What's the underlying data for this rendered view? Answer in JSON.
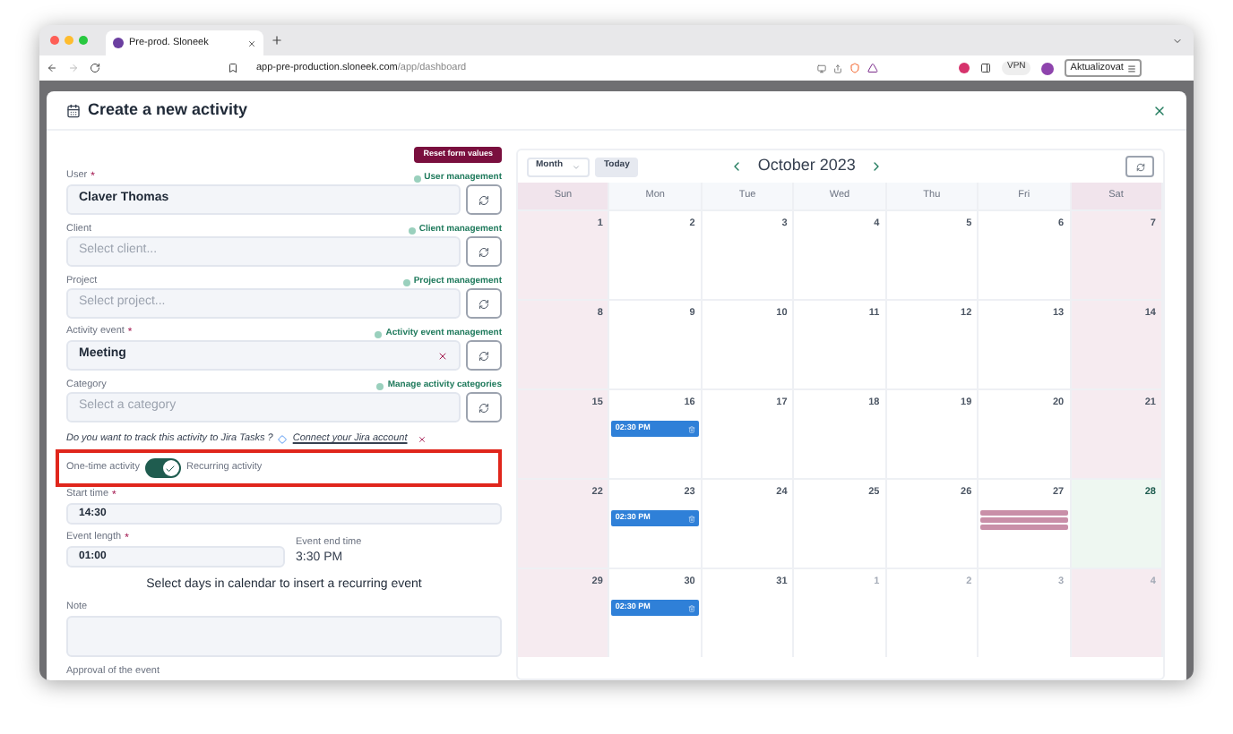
{
  "browser": {
    "tab_title": "Pre-prod. Sloneek",
    "url_host": "app-pre-production.sloneek.com",
    "url_path": "/app/dashboard",
    "vpn": "VPN",
    "update_button": "Aktualizovat"
  },
  "modal": {
    "title": "Create a new activity",
    "reset_button": "Reset form values"
  },
  "fields": [
    {
      "label": "User",
      "required_mark": "*",
      "link": "User management",
      "value": "Claver Thomas",
      "clearable": false
    },
    {
      "label": "Client",
      "link": "Client management",
      "placeholder": "Select client...",
      "clearable": false
    },
    {
      "label": "Project",
      "link": "Project management",
      "placeholder": "Select project...",
      "clearable": false
    },
    {
      "label": "Activity event",
      "required_mark": "*",
      "link": "Activity event management",
      "value": "Meeting",
      "clearable": true
    },
    {
      "label": "Category",
      "link": "Manage activity categories",
      "placeholder": "Select a category",
      "clearable": false
    }
  ],
  "jira": {
    "question": "Do you want to track this activity to Jira Tasks ?",
    "link": "Connect your Jira account"
  },
  "toggle": {
    "left_label": "One-time activity",
    "right_label": "Recurring activity",
    "on": true,
    "highlighted": true
  },
  "start_time": {
    "label": "Start time",
    "required_mark": "*",
    "value": "14:30"
  },
  "event_length": {
    "label": "Event length",
    "required_mark": "*",
    "value": "01:00"
  },
  "end_time": {
    "label": "Event end time",
    "value": "3:30 PM"
  },
  "hint": "Select days in calendar to insert a recurring event",
  "note": {
    "label": "Note"
  },
  "approval": {
    "label": "Approval of the event"
  },
  "calendar": {
    "view": "Month",
    "today_button": "Today",
    "title": "October 2023",
    "weekdays": [
      "Sun",
      "Mon",
      "Tue",
      "Wed",
      "Thu",
      "Fri",
      "Sat"
    ],
    "weeks": [
      [
        {
          "day": "1",
          "muted": false,
          "today": false
        },
        {
          "day": "2",
          "muted": false,
          "today": false
        },
        {
          "day": "3",
          "muted": false,
          "today": false
        },
        {
          "day": "4",
          "muted": false,
          "today": false
        },
        {
          "day": "5",
          "muted": false,
          "today": false
        },
        {
          "day": "6",
          "muted": false,
          "today": false
        },
        {
          "day": "7",
          "muted": false,
          "today": false
        }
      ],
      [
        {
          "day": "8",
          "muted": false,
          "today": false
        },
        {
          "day": "9",
          "muted": false,
          "today": false
        },
        {
          "day": "10",
          "muted": false,
          "today": false
        },
        {
          "day": "11",
          "muted": false,
          "today": false
        },
        {
          "day": "12",
          "muted": false,
          "today": false
        },
        {
          "day": "13",
          "muted": false,
          "today": false
        },
        {
          "day": "14",
          "muted": false,
          "today": false
        }
      ],
      [
        {
          "day": "15",
          "muted": false,
          "today": false
        },
        {
          "day": "16",
          "muted": false,
          "today": false,
          "events": [
            {
              "kind": "time",
              "label": "02:30 PM"
            }
          ]
        },
        {
          "day": "17",
          "muted": false,
          "today": false
        },
        {
          "day": "18",
          "muted": false,
          "today": false
        },
        {
          "day": "19",
          "muted": false,
          "today": false
        },
        {
          "day": "20",
          "muted": false,
          "today": false
        },
        {
          "day": "21",
          "muted": false,
          "today": false
        }
      ],
      [
        {
          "day": "22",
          "muted": false,
          "today": false
        },
        {
          "day": "23",
          "muted": false,
          "today": false,
          "events": [
            {
              "kind": "time",
              "label": "02:30 PM"
            }
          ]
        },
        {
          "day": "24",
          "muted": false,
          "today": false
        },
        {
          "day": "25",
          "muted": false,
          "today": false
        },
        {
          "day": "26",
          "muted": false,
          "today": false
        },
        {
          "day": "27",
          "muted": false,
          "today": false,
          "events": [
            {
              "kind": "bar"
            },
            {
              "kind": "bar"
            },
            {
              "kind": "bar"
            }
          ]
        },
        {
          "day": "28",
          "muted": false,
          "today": true
        }
      ],
      [
        {
          "day": "29",
          "muted": false,
          "today": false
        },
        {
          "day": "30",
          "muted": false,
          "today": false,
          "events": [
            {
              "kind": "time",
              "label": "02:30 PM"
            }
          ]
        },
        {
          "day": "31",
          "muted": false,
          "today": false
        },
        {
          "day": "1",
          "muted": true,
          "today": false
        },
        {
          "day": "2",
          "muted": true,
          "today": false
        },
        {
          "day": "3",
          "muted": true,
          "today": false
        },
        {
          "day": "4",
          "muted": true,
          "today": false
        }
      ]
    ]
  }
}
